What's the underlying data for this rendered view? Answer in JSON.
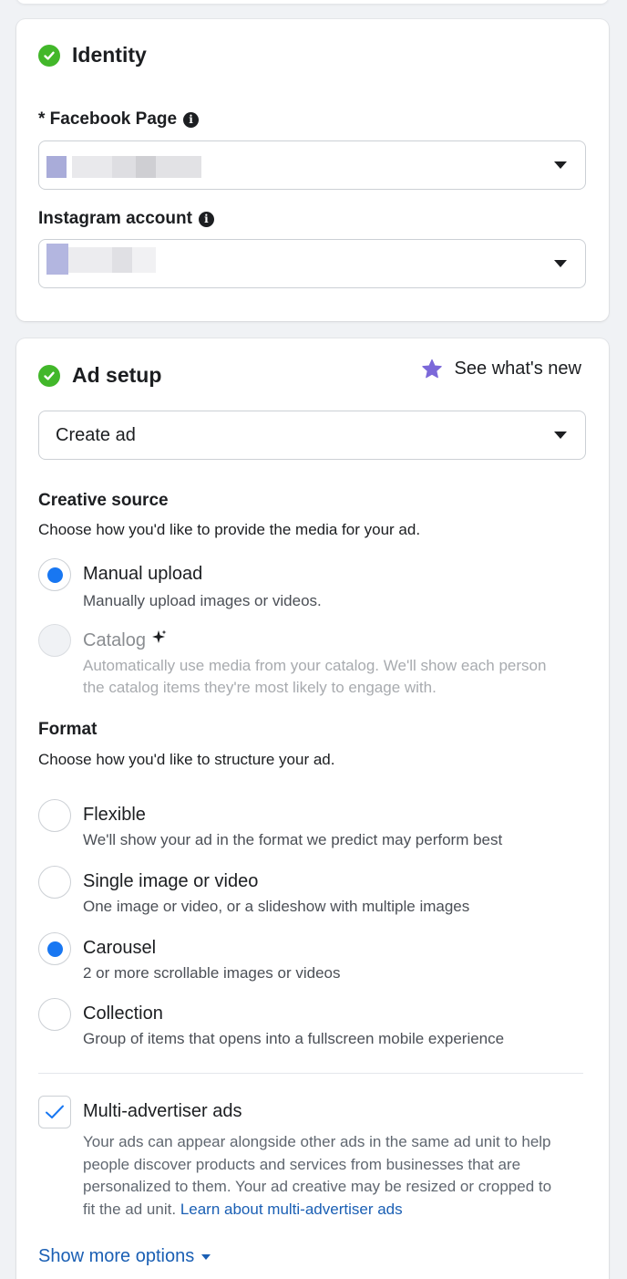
{
  "identity": {
    "title": "Identity",
    "facebook_page": {
      "label": "* Facebook Page"
    },
    "instagram_account": {
      "label": "Instagram account"
    }
  },
  "ad_setup": {
    "title": "Ad setup",
    "whats_new": "See what's new",
    "ad_select": {
      "value": "Create ad"
    },
    "creative_source": {
      "heading": "Creative source",
      "subtext": "Choose how you'd like to provide the media for your ad.",
      "options": [
        {
          "title": "Manual upload",
          "desc": "Manually upload images or videos.",
          "selected": true,
          "disabled": false
        },
        {
          "title": "Catalog",
          "desc_line1": "Automatically use media from your catalog. We'll show each person",
          "desc_line2": "the catalog items they're most likely to engage with.",
          "selected": false,
          "disabled": true
        }
      ]
    },
    "format": {
      "heading": "Format",
      "subtext": "Choose how you'd like to structure your ad.",
      "options": [
        {
          "title": "Flexible",
          "desc": "We'll show your ad in the format we predict may perform best",
          "selected": false
        },
        {
          "title": "Single image or video",
          "desc": "One image or video, or a slideshow with multiple images",
          "selected": false
        },
        {
          "title": "Carousel",
          "desc": "2 or more scrollable images or videos",
          "selected": true
        },
        {
          "title": "Collection",
          "desc": "Group of items that opens into a fullscreen mobile experience",
          "selected": false
        }
      ]
    },
    "multi_advertiser": {
      "label": "Multi-advertiser ads",
      "checked": true,
      "desc_line1": "Your ads can appear alongside other ads in the same ad unit to help",
      "desc_line2": "people discover products and services from businesses that are",
      "desc_line3": "personalized to them. Your ad creative may be resized or cropped to",
      "desc_line4": "fit the ad unit.",
      "link": "Learn about multi-advertiser ads"
    },
    "show_more": "Show more options"
  },
  "colors": {
    "success": "#42b72a",
    "primary": "#1877f2",
    "link": "#1a5fb4",
    "star": "#7b68d9"
  }
}
